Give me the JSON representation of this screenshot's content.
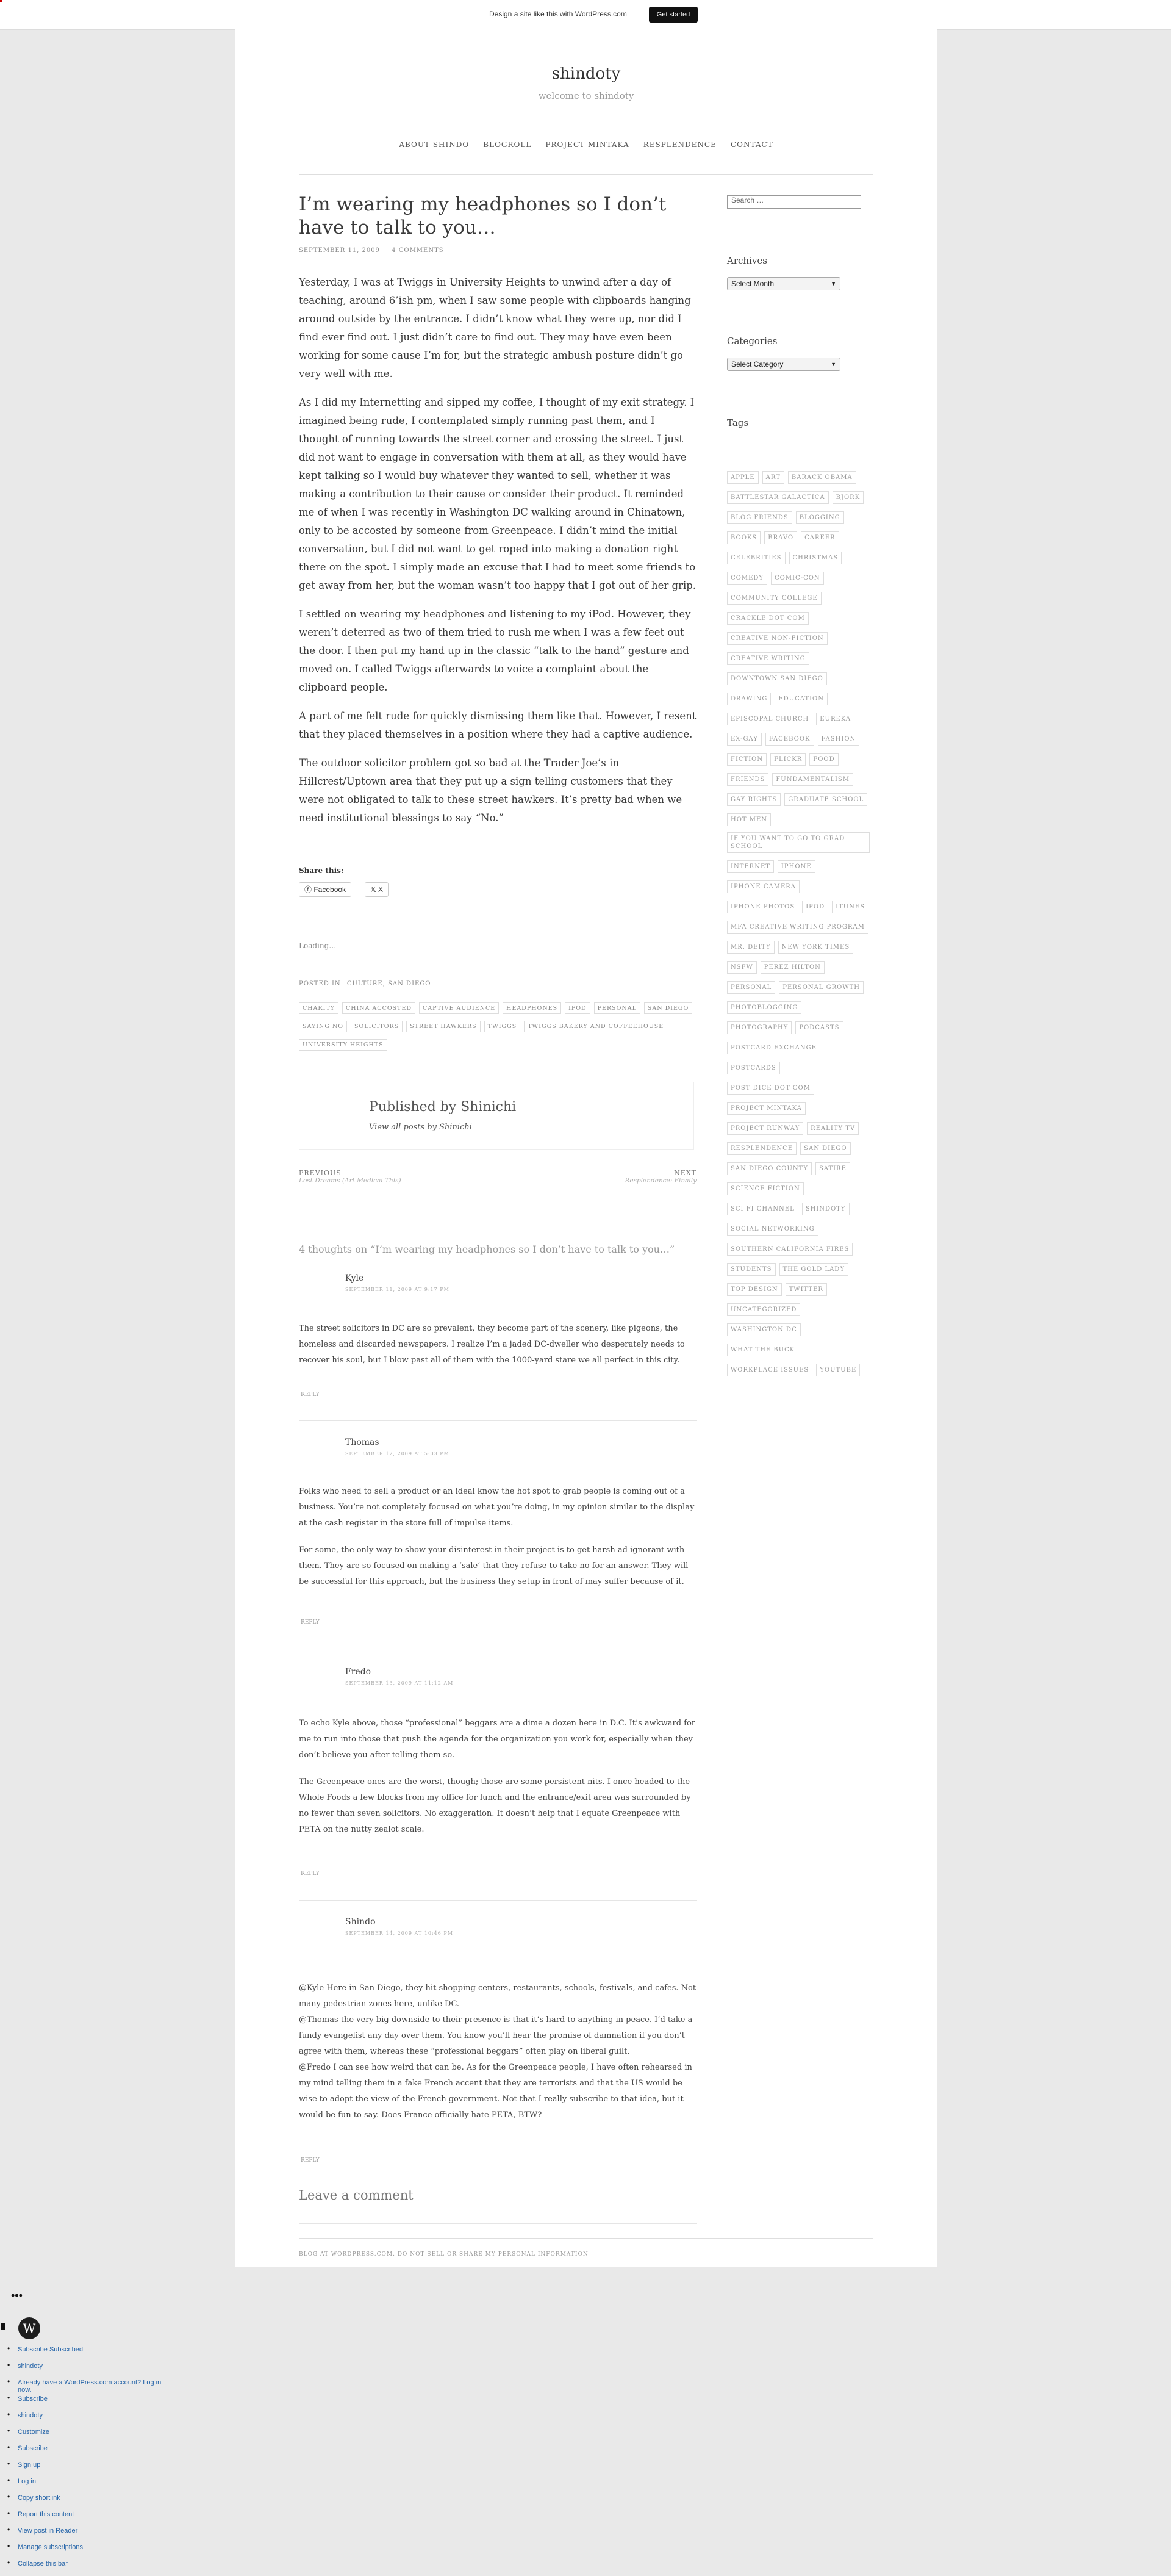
{
  "banner": {
    "message": "Design a site like this with WordPress.com",
    "cta": "Get started"
  },
  "site": {
    "title": "shindoty",
    "tagline": "welcome to shindoty"
  },
  "nav": [
    "ABOUT SHINDO",
    "BLOGROLL",
    "PROJECT MINTAKA",
    "RESPLENDENCE",
    "CONTACT"
  ],
  "post": {
    "title": "I’m wearing my headphones so I don’t have to talk to you…",
    "date": "SEPTEMBER 11, 2009",
    "comments_count": "4 COMMENTS",
    "paragraphs": [
      {
        "before": "Yesterday, I was at ",
        "link1": "Twiggs",
        "mid": " in ",
        "link2": "University Heights",
        "after": " to unwind after a day of teaching, around 6’ish pm,  when I saw some people with clipboards hanging around outside by the entrance. I didn’t know what they were up, nor did I find ever find out. I just didn’t care to find out. They may have even been working for some cause I’m for, but the strategic ambush posture didn’t go very well with me."
      },
      {
        "before": "As I did my Internetting and sipped my coffee, I thought of my exit strategy. I imagined being rude, I contemplated simply running past them, and I thought of running towards the street corner and crossing the street. I just did not want to engage in conversation with them at all, as they would have kept talking so I would buy whatever they wanted to sell, whether it was making a contribution to their cause or consider their product. It reminded me of when I was recently in Washington DC walking around in Chinatown, only to be accosted by someone from ",
        "link1": "Greenpeace",
        "after": ". I didn’t mind the initial conversation, but I did not want to get roped into making a donation right there on the spot. I simply made an excuse that I had to meet some friends to get away from her, but the woman wasn’t too happy that I got out of her grip."
      },
      {
        "before": "I settled on wearing my headphones and listening to my ",
        "link1": "iPod",
        "after": ". However, they weren’t deterred as two of them tried to rush me when I was a few feet out the door. I then put my hand up in the classic “talk to the hand” gesture and moved on. I called Twiggs afterwards to voice a complaint about the clipboard people."
      },
      {
        "before": "A part of me felt rude for quickly dismissing them like that. However, I resent that they placed themselves in a position where they had a captive audience."
      },
      {
        "before": "The outdoor solicitor problem got so bad at the ",
        "link1": "Trader Joe’s",
        "mid": " in ",
        "link2": "Hillcrest/Uptown",
        "after": " area that they put up a sign telling customers that they were not obligated to talk to these street hawkers. It’s pretty bad when we need institutional blessings to say “No.”"
      }
    ],
    "share_label": "Share this:",
    "share_buttons": [
      "Facebook",
      "X"
    ],
    "loading": "Loading…",
    "posted_in_label": "POSTED IN",
    "categories": [
      "CULTURE",
      "SAN DIEGO"
    ],
    "tags": [
      "CHARITY",
      "CHINA ACCOSTED",
      "CAPTIVE AUDIENCE",
      "HEADPHONES",
      "IPOD",
      "PERSONAL",
      "SAN DIEGO",
      "SAYING NO",
      "SOLICITORS",
      "STREET HAWKERS",
      "TWIGGS",
      "TWIGGS BAKERY AND COFFEEHOUSE",
      "UNIVERSITY HEIGHTS"
    ],
    "author": {
      "published_by": "Published by Shinichi",
      "view_all": "View all posts by Shinichi"
    },
    "prev": {
      "label": "PREVIOUS",
      "title": "Lost Dreams (Art Medical This)"
    },
    "next": {
      "label": "NEXT",
      "title": "Resplendence: Finally"
    }
  },
  "comments_title": "4 thoughts on “I’m wearing my headphones so I don’t have to talk to you…”",
  "comments": [
    {
      "name": "Kyle",
      "date": "SEPTEMBER 11, 2009 AT 9:17 PM",
      "paragraphs": [
        "The street solicitors in DC are so prevalent, they become part of the scenery, like pigeons, the homeless and discarded newspapers. I realize I’m a jaded DC-dweller who desperately needs to recover his soul, but I blow past all of them with the 1000-yard stare we all perfect in this city."
      ],
      "reply": "REPLY"
    },
    {
      "name": "Thomas",
      "date": "SEPTEMBER 12, 2009 AT 5:03 PM",
      "paragraphs": [
        "Folks who need to sell a product or an ideal know the hot spot to grab people is coming out of a business. You’re not completely focused on what you’re doing, in my opinion similar to the display at the cash register in the store full of impulse items.",
        "For some, the only way to show your disinterest in their project is to get harsh ad ignorant with them. They are so focused on making a ‘sale’ that they refuse to take no for an answer. They will be successful for this approach, but the business they setup in front of may suffer because of it."
      ],
      "reply": "REPLY"
    },
    {
      "name": "Fredo",
      "date": "SEPTEMBER 13, 2009 AT 11:12 AM",
      "paragraphs": [
        "To echo Kyle above, those “professional” beggars are a dime a dozen here in D.C. It’s awkward for me to run into those that push the agenda for the organization you work for, especially when they don’t believe you after telling them so.",
        "The Greenpeace ones are the worst, though; those are some persistent nits. I once headed to the Whole Foods a few blocks from my office for lunch and the entrance/exit area was surrounded by no fewer than seven solicitors. No exaggeration. It doesn’t help that I equate Greenpeace with PETA on the nutty zealot scale."
      ],
      "reply": "REPLY"
    },
    {
      "name": "Shindo",
      "date": "SEPTEMBER 14, 2009 AT 10:46 PM",
      "paragraphs": [
        "@Kyle Here in San Diego, they hit shopping centers, restaurants, schools, festivals, and cafes. Not many pedestrian zones here, unlike DC.\n@Thomas the very big downside to their presence is that it’s hard to anything in peace. I’d take a fundy evangelist any day over them. You know you’ll hear the promise of damnation if you don’t agree with them, whereas these “professional beggars” often play on liberal guilt.\n@Fredo I can see how weird that can be. As for the Greenpeace people, I have often rehearsed in my mind telling them in a fake French accent that they are terrorists and that the US would be wise to adopt the view of the French government. Not that I really subscribe to that idea, but it would be fun to say. Does France officially hate PETA, BTW?"
      ],
      "reply": "REPLY"
    }
  ],
  "leave_comment": "Leave a comment",
  "footer_link": "BLOG AT WORDPRESS.COM. DO NOT SELL OR SHARE MY PERSONAL INFORMATION",
  "sidebar": {
    "search_placeholder": "Search …",
    "archives_title": "Archives",
    "archives_select": "Select Month",
    "categories_title": "Categories",
    "categories_select": "Select Category",
    "tags_title": "Tags",
    "tags": [
      "APPLE",
      "ART",
      "BARACK OBAMA",
      "BATTLESTAR GALACTICA",
      "BJORK",
      "BLOG FRIENDS",
      "BLOGGING",
      "BOOKS",
      "BRAVO",
      "CAREER",
      "CELEBRITIES",
      "CHRISTMAS",
      "COMEDY",
      "COMIC-CON",
      "COMMUNITY COLLEGE",
      "CRACKLE DOT COM",
      "CREATIVE NON-FICTION",
      "CREATIVE WRITING",
      "DOWNTOWN SAN DIEGO",
      "DRAWING",
      "EDUCATION",
      "EPISCOPAL CHURCH",
      "EUREKA",
      "EX-GAY",
      "FACEBOOK",
      "FASHION",
      "FICTION",
      "FLICKR",
      "FOOD",
      "FRIENDS",
      "FUNDAMENTALISM",
      "GAY RIGHTS",
      "GRADUATE SCHOOL",
      "HOT MEN",
      "IF YOU WANT TO GO TO GRAD SCHOOL",
      "INTERNET",
      "IPHONE",
      "IPHONE CAMERA",
      "IPHONE PHOTOS",
      "IPOD",
      "ITUNES",
      "MFA CREATIVE WRITING PROGRAM",
      "MR. DEITY",
      "NEW YORK TIMES",
      "NSFW",
      "PEREZ HILTON",
      "PERSONAL",
      "PERSONAL GROWTH",
      "PHOTOBLOGGING",
      "PHOTOGRAPHY",
      "PODCASTS",
      "POSTCARD EXCHANGE",
      "POSTCARDS",
      "POST DICE DOT COM",
      "PROJECT MINTAKA",
      "PROJECT RUNWAY",
      "REALITY TV",
      "RESPLENDENCE",
      "SAN DIEGO",
      "SAN DIEGO COUNTY",
      "SATIRE",
      "SCIENCE FICTION",
      "SCI FI CHANNEL",
      "SHINDOTY",
      "SOCIAL NETWORKING",
      "SOUTHERN CALIFORNIA FIRES",
      "STUDENTS",
      "THE GOLD LADY",
      "TOP DESIGN",
      "TWITTER",
      "UNCATEGORIZED",
      "WASHINGTON DC",
      "WHAT THE BUCK",
      "WORKPLACE ISSUES",
      "YOUTUBE"
    ]
  },
  "admin": {
    "dots": "•••",
    "logo": "W",
    "items": [
      "Subscribe Subscribed",
      "shindoty",
      "Already have a WordPress.com account? Log in now.",
      "Subscribe",
      "shindoty",
      "Customize",
      "Subscribe",
      "Sign up",
      "Log in",
      "Copy shortlink",
      "Report this content",
      "View post in Reader",
      "Manage subscriptions",
      "Collapse this bar"
    ]
  }
}
